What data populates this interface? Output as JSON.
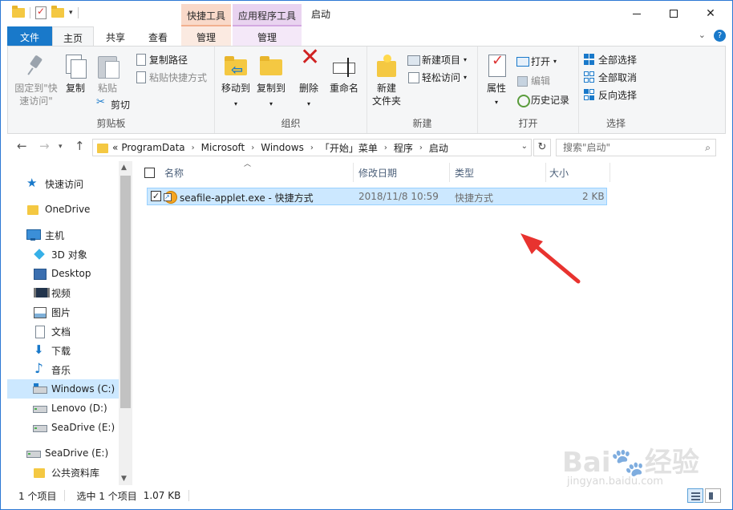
{
  "window": {
    "title": "启动",
    "context_tab_shortcut": "快捷工具",
    "context_tab_app": "应用程序工具"
  },
  "tabs": {
    "file": "文件",
    "home": "主页",
    "share": "共享",
    "view": "查看",
    "manage1": "管理",
    "manage2": "管理"
  },
  "ribbon": {
    "clipboard": {
      "label": "剪贴板",
      "pin": "固定到\"快\n速访问\"",
      "copy": "复制",
      "paste": "粘贴",
      "copy_path": "复制路径",
      "paste_shortcut": "粘贴快捷方式",
      "cut": "剪切"
    },
    "organize": {
      "label": "组织",
      "move_to": "移动到",
      "copy_to": "复制到",
      "delete": "删除",
      "rename": "重命名"
    },
    "new": {
      "label": "新建",
      "new_folder": "新建\n文件夹",
      "new_item": "新建项目",
      "easy_access": "轻松访问"
    },
    "open": {
      "label": "打开",
      "properties": "属性",
      "open": "打开",
      "edit": "编辑",
      "history": "历史记录"
    },
    "select": {
      "label": "选择",
      "select_all": "全部选择",
      "select_none": "全部取消",
      "invert": "反向选择"
    }
  },
  "address": {
    "prefix": "«",
    "crumbs": [
      "ProgramData",
      "Microsoft",
      "Windows",
      "「开始」菜单",
      "程序",
      "启动"
    ],
    "search_placeholder": "搜索\"启动\""
  },
  "nav": {
    "quick_access": "快速访问",
    "onedrive": "OneDrive",
    "this_pc": "主机",
    "objects3d": "3D 对象",
    "desktop": "Desktop",
    "videos": "视频",
    "pictures": "图片",
    "documents": "文档",
    "downloads": "下载",
    "music": "音乐",
    "drive_c": "Windows (C:)",
    "drive_d": "Lenovo (D:)",
    "drive_e": "SeaDrive (E:)",
    "seadrive_root": "SeaDrive (E:)",
    "public_lib": "公共资料库"
  },
  "columns": {
    "name": "名称",
    "date": "修改日期",
    "type": "类型",
    "size": "大小"
  },
  "files": [
    {
      "name": "seafile-applet.exe - 快捷方式",
      "date": "2018/11/8 10:59",
      "type": "快捷方式",
      "size": "2 KB",
      "checked": "✓"
    }
  ],
  "status": {
    "count": "1 个项目",
    "selected": "选中 1 个项目",
    "size": "1.07 KB"
  },
  "watermark": {
    "brand": "Bai🐾经验",
    "url": "jingyan.baidu.com"
  }
}
